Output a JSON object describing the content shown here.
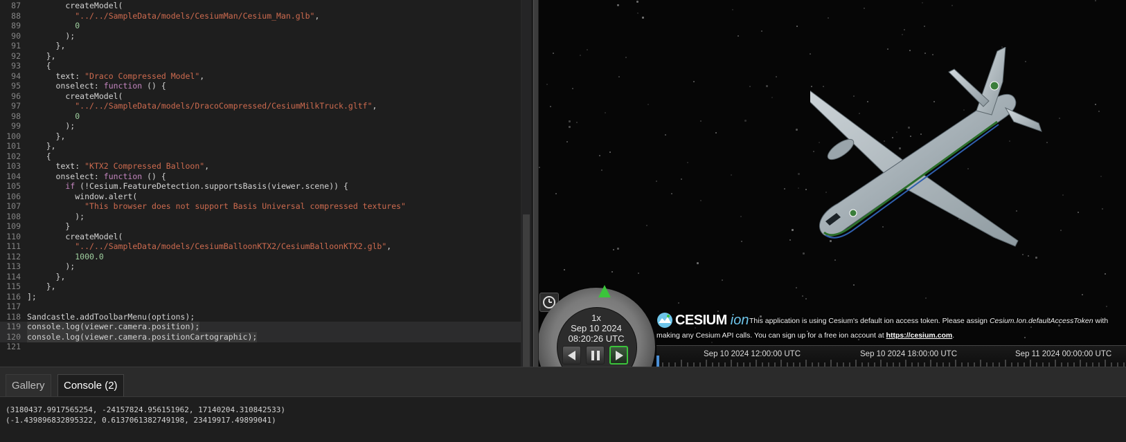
{
  "editor": {
    "lines": [
      {
        "num": "87",
        "segs": [
          {
            "t": "        createModel(",
            "c": ""
          }
        ]
      },
      {
        "num": "88",
        "segs": [
          {
            "t": "          ",
            "c": ""
          },
          {
            "t": "\"../../SampleData/models/CesiumMan/Cesium_Man.glb\"",
            "c": "t-str"
          },
          {
            "t": ",",
            "c": ""
          }
        ]
      },
      {
        "num": "89",
        "segs": [
          {
            "t": "          ",
            "c": ""
          },
          {
            "t": "0",
            "c": "t-num"
          }
        ]
      },
      {
        "num": "90",
        "segs": [
          {
            "t": "        );",
            "c": ""
          }
        ]
      },
      {
        "num": "91",
        "segs": [
          {
            "t": "      },",
            "c": ""
          }
        ]
      },
      {
        "num": "92",
        "segs": [
          {
            "t": "    },",
            "c": ""
          }
        ]
      },
      {
        "num": "93",
        "segs": [
          {
            "t": "    {",
            "c": ""
          }
        ]
      },
      {
        "num": "94",
        "segs": [
          {
            "t": "      text: ",
            "c": ""
          },
          {
            "t": "\"Draco Compressed Model\"",
            "c": "t-str"
          },
          {
            "t": ",",
            "c": ""
          }
        ]
      },
      {
        "num": "95",
        "segs": [
          {
            "t": "      onselect: ",
            "c": ""
          },
          {
            "t": "function",
            "c": "t-kw"
          },
          {
            "t": " () {",
            "c": ""
          }
        ]
      },
      {
        "num": "96",
        "segs": [
          {
            "t": "        createModel(",
            "c": ""
          }
        ]
      },
      {
        "num": "97",
        "segs": [
          {
            "t": "          ",
            "c": ""
          },
          {
            "t": "\"../../SampleData/models/DracoCompressed/CesiumMilkTruck.gltf\"",
            "c": "t-str"
          },
          {
            "t": ",",
            "c": ""
          }
        ]
      },
      {
        "num": "98",
        "segs": [
          {
            "t": "          ",
            "c": ""
          },
          {
            "t": "0",
            "c": "t-num"
          }
        ]
      },
      {
        "num": "99",
        "segs": [
          {
            "t": "        );",
            "c": ""
          }
        ]
      },
      {
        "num": "100",
        "segs": [
          {
            "t": "      },",
            "c": ""
          }
        ]
      },
      {
        "num": "101",
        "segs": [
          {
            "t": "    },",
            "c": ""
          }
        ]
      },
      {
        "num": "102",
        "segs": [
          {
            "t": "    {",
            "c": ""
          }
        ]
      },
      {
        "num": "103",
        "segs": [
          {
            "t": "      text: ",
            "c": ""
          },
          {
            "t": "\"KTX2 Compressed Balloon\"",
            "c": "t-str"
          },
          {
            "t": ",",
            "c": ""
          }
        ]
      },
      {
        "num": "104",
        "segs": [
          {
            "t": "      onselect: ",
            "c": ""
          },
          {
            "t": "function",
            "c": "t-kw"
          },
          {
            "t": " () {",
            "c": ""
          }
        ]
      },
      {
        "num": "105",
        "segs": [
          {
            "t": "        ",
            "c": ""
          },
          {
            "t": "if",
            "c": "t-kw"
          },
          {
            "t": " (!Cesium.FeatureDetection.supportsBasis(viewer.scene)) {",
            "c": ""
          }
        ]
      },
      {
        "num": "106",
        "segs": [
          {
            "t": "          window.alert(",
            "c": ""
          }
        ]
      },
      {
        "num": "107",
        "segs": [
          {
            "t": "            ",
            "c": ""
          },
          {
            "t": "\"This browser does not support Basis Universal compressed textures\"",
            "c": "t-str"
          }
        ]
      },
      {
        "num": "108",
        "segs": [
          {
            "t": "          );",
            "c": ""
          }
        ]
      },
      {
        "num": "109",
        "segs": [
          {
            "t": "        }",
            "c": ""
          }
        ]
      },
      {
        "num": "110",
        "segs": [
          {
            "t": "        createModel(",
            "c": ""
          }
        ]
      },
      {
        "num": "111",
        "segs": [
          {
            "t": "          ",
            "c": ""
          },
          {
            "t": "\"../../SampleData/models/CesiumBalloonKTX2/CesiumBalloonKTX2.glb\"",
            "c": "t-str"
          },
          {
            "t": ",",
            "c": ""
          }
        ]
      },
      {
        "num": "112",
        "segs": [
          {
            "t": "          ",
            "c": ""
          },
          {
            "t": "1000.0",
            "c": "t-num"
          }
        ]
      },
      {
        "num": "113",
        "segs": [
          {
            "t": "        );",
            "c": ""
          }
        ]
      },
      {
        "num": "114",
        "segs": [
          {
            "t": "      },",
            "c": ""
          }
        ]
      },
      {
        "num": "115",
        "segs": [
          {
            "t": "    },",
            "c": ""
          }
        ]
      },
      {
        "num": "116",
        "segs": [
          {
            "t": "];",
            "c": ""
          }
        ]
      },
      {
        "num": "117",
        "segs": [
          {
            "t": "",
            "c": ""
          }
        ]
      },
      {
        "num": "118",
        "segs": [
          {
            "t": "Sandcastle.addToolbarMenu(options);",
            "c": ""
          }
        ]
      },
      {
        "num": "119",
        "segs": [
          {
            "t": "console.log(viewer.camera.position);",
            "c": ""
          }
        ],
        "highlight": true
      },
      {
        "num": "120",
        "segs": [
          {
            "t": "console.log(viewer.camera.positionCartographic);",
            "c": ""
          }
        ],
        "highlight": true
      },
      {
        "num": "121",
        "segs": [
          {
            "t": "",
            "c": ""
          }
        ]
      }
    ]
  },
  "viewer": {
    "animation": {
      "speed": "1x",
      "date": "Sep 10 2024",
      "time": "08:20:26 UTC"
    },
    "credits": {
      "logo_word": "CESIUM",
      "logo_suffix": "ion",
      "line1_prefix": "This application is using Cesium's default ion access token. Please assign ",
      "line1_code": "Cesium.Ion.defaultAccessToken",
      "line1_suffix": " with",
      "line2_prefix": "making any Cesium API calls. You can sign up for a free ion account at ",
      "line2_link": "https://cesium.com",
      "line2_suffix": "."
    },
    "timeline": {
      "labels": [
        "Sep 10 2024 12:00:00 UTC",
        "Sep 10 2024 18:00:00 UTC",
        "Sep 11 2024 00:00:00 UTC"
      ]
    }
  },
  "bottom_panel": {
    "tabs": [
      {
        "label": "Gallery",
        "active": false
      },
      {
        "label": "Console (2)",
        "active": true
      }
    ],
    "console_lines": [
      "(3180437.9917565254, -24157824.956151962, 17140204.310842533)",
      "(-1.439896832895322, 0.6137061382749198, 23419917.49899041)"
    ]
  },
  "colors": {
    "accent_green": "#3bc43b",
    "string": "#ce6b4f",
    "number": "#9fcf9f",
    "keyword": "#c586c0"
  }
}
